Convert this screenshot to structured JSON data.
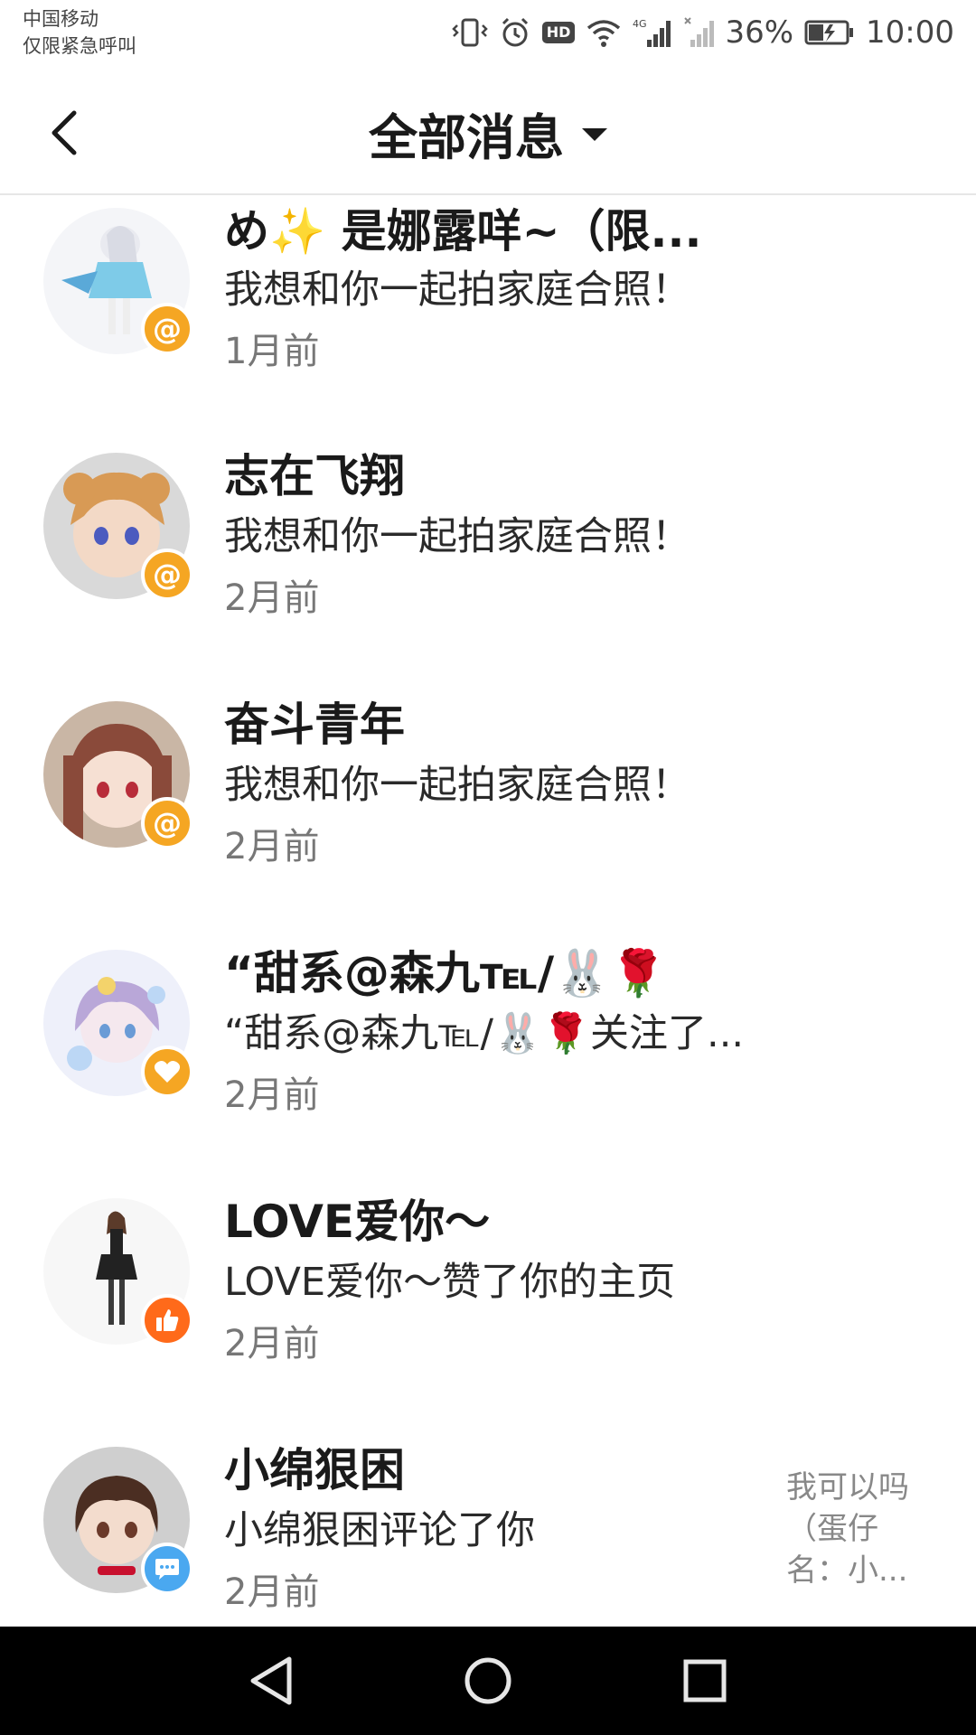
{
  "status_bar": {
    "carrier_line1": "中国移动",
    "carrier_line2": "仅限紧急呼叫",
    "hd": "HD",
    "battery_percent": "36%",
    "time": "10:00"
  },
  "header": {
    "title": "全部消息",
    "back_icon": "chevron-left-icon",
    "dropdown_icon": "caret-down-icon"
  },
  "messages": [
    {
      "name": "め✨ 是娜露咩~（限...",
      "text": "我想和你一起拍家庭合照！",
      "time": "1月前",
      "badge": "at",
      "badge_color": "#f5a623"
    },
    {
      "name": "志在飞翔",
      "text": "我想和你一起拍家庭合照！",
      "time": "2月前",
      "badge": "at",
      "badge_color": "#f5a623"
    },
    {
      "name": "奋斗青年",
      "text": "我想和你一起拍家庭合照！",
      "time": "2月前",
      "badge": "at",
      "badge_color": "#f5a623"
    },
    {
      "name": "“甜系@森九℡/🐰🌹",
      "text": "“甜系@森九℡/🐰🌹关注了...",
      "time": "2月前",
      "badge": "heart",
      "badge_color": "#f5a623"
    },
    {
      "name": "LOVE爱你～",
      "text": "LOVE爱你～赞了你的主页",
      "time": "2月前",
      "badge": "thumb",
      "badge_color": "#ff6a1a"
    },
    {
      "name": "小绵狠困",
      "text": "小绵狠困评论了你",
      "time": "2月前",
      "badge": "comment",
      "badge_color": "#4aa8f0",
      "preview": "我可以吗（蛋仔名：小..."
    }
  ],
  "colors": {
    "accent_orange": "#f5a623",
    "like_orange": "#ff6a1a",
    "comment_blue": "#4aa8f0"
  }
}
